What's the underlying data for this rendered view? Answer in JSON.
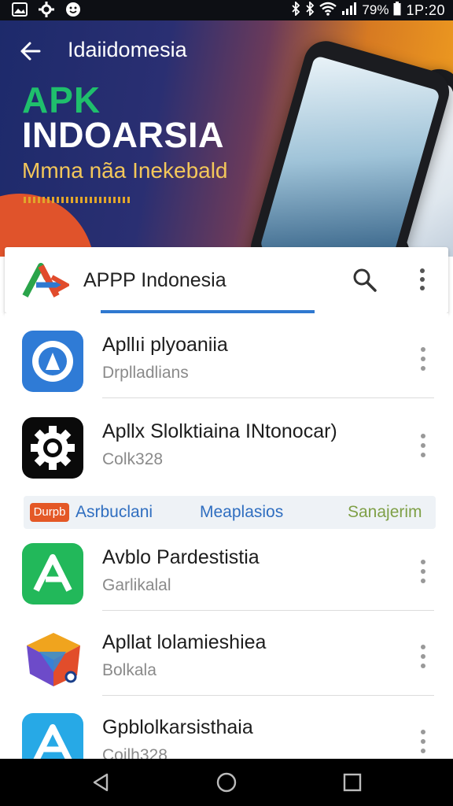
{
  "status_bar": {
    "left_icons": [
      "gallery-icon",
      "settings-icon",
      "emoji-icon"
    ],
    "battery": "79%",
    "time": "1P:20"
  },
  "banner": {
    "nav_title": "Idaiidomesia",
    "apk_text": "APK",
    "headline": "INDOARSIA",
    "tagline": "Mmna nãa Inekebald"
  },
  "app_bar": {
    "title": "APPP Indonesia",
    "search_icon": "search-icon",
    "menu_icon": "more-vert-icon"
  },
  "apps": [
    {
      "title": "Apllıi plyoaniia",
      "subtitle": "Drplladlians",
      "icon": "round-logo-icon"
    },
    {
      "title": "Apllx Slolktiaina INtonocar)",
      "subtitle": "Colk328",
      "icon": "gear-icon"
    },
    {
      "title": "Avblo Pardestistia",
      "subtitle": "Garlikalal",
      "icon": "triangle-a-icon"
    },
    {
      "title": "Apllat lolamieshiea",
      "subtitle": "Bolkala",
      "icon": "origami-icon"
    },
    {
      "title": "Gpblolkarsisthaia",
      "subtitle": "Coilh328",
      "icon": "cyan-a-icon"
    }
  ],
  "category_bar": {
    "badge": "Durpb",
    "items": [
      "Asrbuclani",
      "Meaplasios",
      "Sanajerim"
    ]
  },
  "colors": {
    "accent": "#2f78d0",
    "apk_green": "#1fbf6c",
    "tagline_gold": "#f3c75a"
  }
}
